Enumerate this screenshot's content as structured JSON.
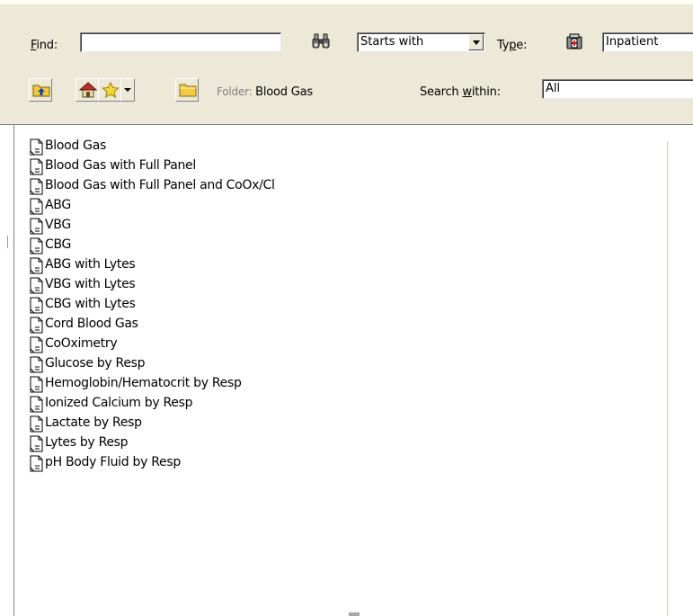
{
  "find": {
    "label_prefix": "",
    "label_accel": "F",
    "label_rest": "ind:",
    "value": ""
  },
  "match_mode": {
    "selected": "Starts with"
  },
  "type": {
    "label_pre": "Ty",
    "label_accel": "p",
    "label_post": "e:",
    "selected": "Inpatient"
  },
  "folder": {
    "label": "Folder:",
    "name": "Blood Gas"
  },
  "search_within": {
    "label_pre": "Search ",
    "label_accel": "w",
    "label_post": "ithin:",
    "selected": "All"
  },
  "items": [
    {
      "label": "Blood Gas"
    },
    {
      "label": "Blood Gas with Full Panel"
    },
    {
      "label": "Blood Gas with Full Panel and CoOx/Cl"
    },
    {
      "label": "ABG"
    },
    {
      "label": "VBG"
    },
    {
      "label": "CBG"
    },
    {
      "label": "ABG with Lytes"
    },
    {
      "label": "VBG with Lytes"
    },
    {
      "label": "CBG with Lytes"
    },
    {
      "label": "Cord Blood Gas"
    },
    {
      "label": "CoOximetry"
    },
    {
      "label": "Glucose by Resp"
    },
    {
      "label": "Hemoglobin/Hematocrit by Resp"
    },
    {
      "label": "Ionized Calcium by Resp"
    },
    {
      "label": "Lactate by Resp"
    },
    {
      "label": "Lytes by Resp"
    },
    {
      "label": "pH Body Fluid by Resp"
    }
  ],
  "icons": {
    "binoculars": "binoculars-icon",
    "type": "medical-kit-icon",
    "up": "folder-up-icon",
    "home": "home-icon",
    "favorites": "star-icon",
    "folder": "folder-icon",
    "document": "document-icon"
  },
  "colors": {
    "toolbar_bg": "#ece9d8",
    "list_bg": "#ffffff"
  }
}
